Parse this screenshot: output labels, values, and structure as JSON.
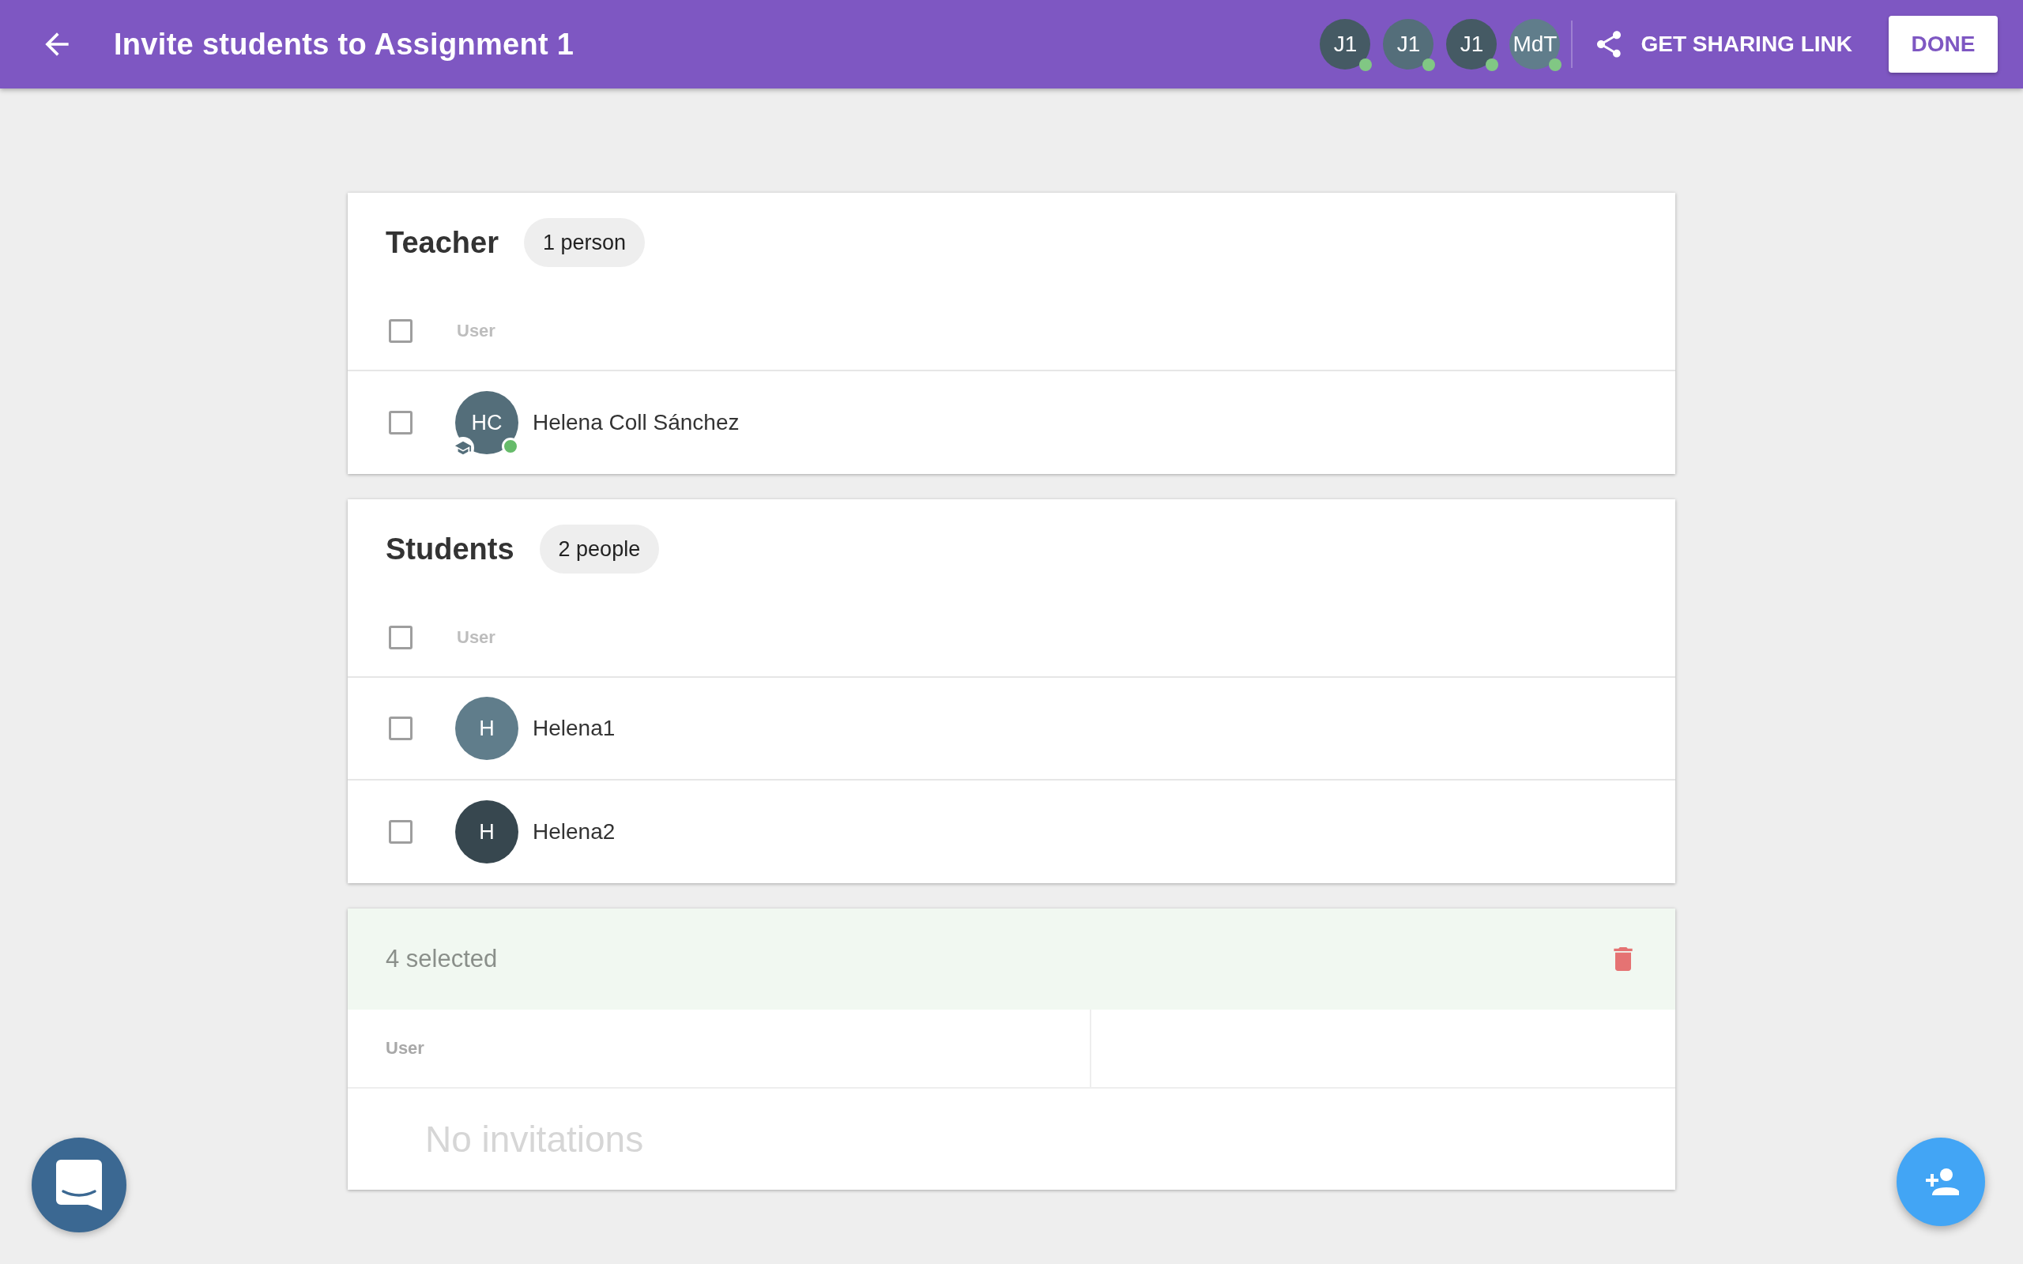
{
  "header": {
    "title": "Invite students to Assignment 1",
    "collaborators": [
      {
        "initials": "J1",
        "color": "#455a64",
        "online": true
      },
      {
        "initials": "J1",
        "color": "#546e7a",
        "online": true
      },
      {
        "initials": "J1",
        "color": "#455a64",
        "online": true
      },
      {
        "initials": "MdT",
        "color": "#607d8b",
        "online": true
      }
    ],
    "share_link": "GET SHARING LINK",
    "done": "DONE"
  },
  "sections": [
    {
      "title": "Teacher",
      "count": "1 person",
      "column": "User",
      "header_checked": false,
      "people": [
        {
          "initials": "HC",
          "name": "Helena Coll Sánchez",
          "color": "#546e7a",
          "online": true,
          "teacher": true,
          "checked": false
        }
      ]
    },
    {
      "title": "Students",
      "count": "2 people",
      "column": "User",
      "header_checked": false,
      "people": [
        {
          "initials": "H",
          "name": "Helena1",
          "color": "#607d8b",
          "online": false,
          "teacher": false,
          "checked": false
        },
        {
          "initials": "H",
          "name": "Helena2",
          "color": "#37474f",
          "online": false,
          "teacher": false,
          "checked": false
        }
      ]
    }
  ],
  "selection": {
    "count": "4 selected",
    "column": "User",
    "empty_message": "No invitations"
  }
}
